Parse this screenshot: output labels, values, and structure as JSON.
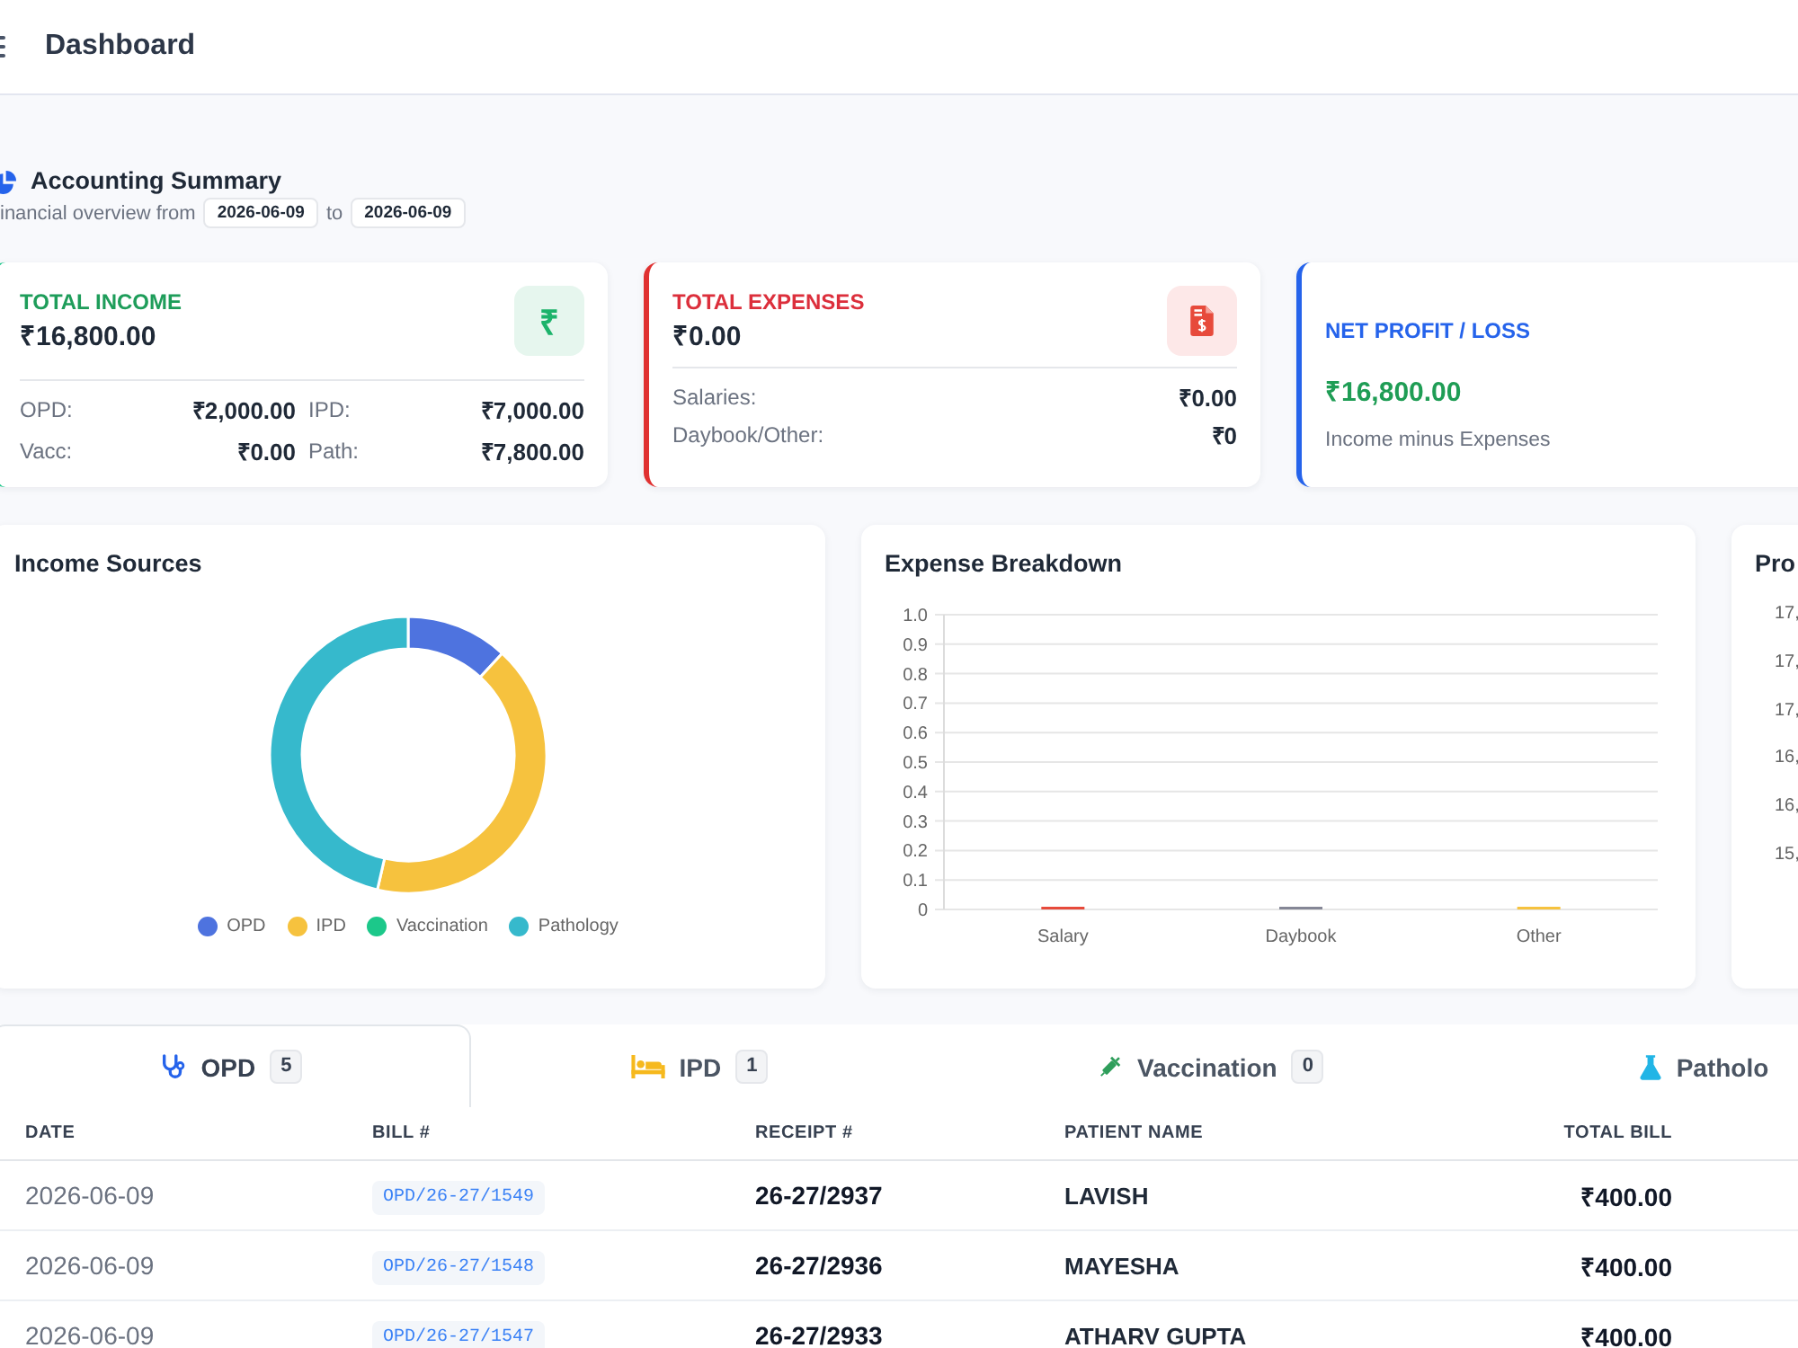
{
  "header": {
    "title": "Dashboard"
  },
  "summary": {
    "title": "Accounting Summary",
    "subtitle": "inancial overview from",
    "from_date": "2026-06-09",
    "separator": "to",
    "to_date": "2026-06-09"
  },
  "cards": [
    {
      "kind": "income",
      "label": "TOTAL INCOME",
      "value": "₹16,800.00",
      "icon": "₹",
      "breakdown": [
        {
          "label": "OPD:",
          "value": "₹2,000.00"
        },
        {
          "label": "IPD:",
          "value": "₹7,000.00"
        },
        {
          "label": "Vacc:",
          "value": "₹0.00"
        },
        {
          "label": "Path:",
          "value": "₹7,800.00"
        }
      ]
    },
    {
      "kind": "expense",
      "label": "TOTAL EXPENSES",
      "value": "₹0.00",
      "breakdown": [
        {
          "label": "Salaries:",
          "value": "₹0.00"
        },
        {
          "label": "Daybook/Other:",
          "value": "₹0"
        }
      ]
    },
    {
      "kind": "net",
      "label": "NET PROFIT / LOSS",
      "value": "₹16,800.00",
      "note": "Income minus Expenses"
    }
  ],
  "charts": [
    {
      "chart_data": {
        "type": "donut",
        "title": "Income Sources",
        "categories": [
          "OPD",
          "IPD",
          "Vaccination",
          "Pathology"
        ],
        "values": [
          11.9,
          41.67,
          0,
          46.43
        ],
        "colors": [
          "#4e73df",
          "#f6c23e",
          "#1cc88a",
          "#36b9cc"
        ]
      }
    },
    {
      "chart_data": {
        "type": "bar",
        "title": "Expense Breakdown",
        "categories": [
          "Salary",
          "Daybook",
          "Other"
        ],
        "values": [
          0,
          0,
          0
        ],
        "colors": [
          "#e74a3b",
          "#858796",
          "#f6c23e"
        ],
        "ylim": [
          0,
          1
        ],
        "yticks": [
          0,
          0.1,
          0.2,
          0.3,
          0.4,
          0.5,
          0.6,
          0.7,
          0.8,
          0.9,
          {
            "value": 1,
            "label": "1.0"
          }
        ],
        "grid": true
      }
    },
    {
      "kind": "cropped",
      "title": "Pro",
      "tick_labels": [
        "17,",
        "17,",
        "17,",
        "16,",
        "16,",
        "15,"
      ]
    }
  ],
  "tabs": [
    {
      "kind": "opd",
      "label": "OPD",
      "count": "5",
      "selected": true
    },
    {
      "kind": "ipd",
      "label": "IPD",
      "count": "1",
      "selected": false
    },
    {
      "kind": "vaccination",
      "label": "Vaccination",
      "count": "0",
      "selected": false
    },
    {
      "kind": "pathology",
      "label": "Patholo",
      "selected": false
    }
  ],
  "table": {
    "columns": [
      "DATE",
      "BILL #",
      "RECEIPT #",
      "PATIENT NAME",
      "TOTAL BILL"
    ],
    "rows": [
      [
        "2026-06-09",
        "OPD/26-27/1549",
        "26-27/2937",
        "LAVISH",
        "₹400.00"
      ],
      [
        "2026-06-09",
        "OPD/26-27/1548",
        "26-27/2936",
        "MAYESHA",
        "₹400.00"
      ],
      [
        "2026-06-09",
        "OPD/26-27/1547",
        "26-27/2933",
        "ATHARV GUPTA",
        "₹400.00"
      ]
    ]
  }
}
